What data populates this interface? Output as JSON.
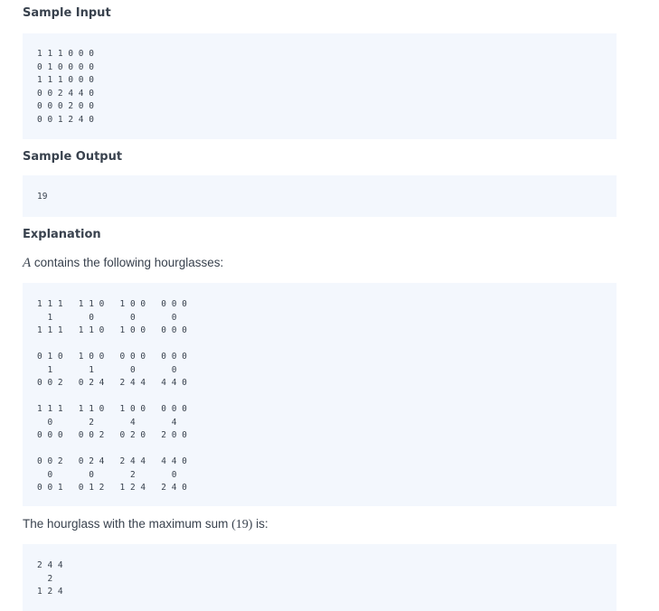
{
  "sample_input": {
    "heading": "Sample Input",
    "code": "1 1 1 0 0 0\n0 1 0 0 0 0\n1 1 1 0 0 0\n0 0 2 4 4 0\n0 0 0 2 0 0\n0 0 1 2 4 0"
  },
  "sample_output": {
    "heading": "Sample Output",
    "code": "19"
  },
  "explanation": {
    "heading": "Explanation",
    "math_var": "A",
    "intro_text": " contains the following hourglasses:",
    "hourglasses_code": "1 1 1   1 1 0   1 0 0   0 0 0\n  1       0       0       0\n1 1 1   1 1 0   1 0 0   0 0 0\n\n0 1 0   1 0 0   0 0 0   0 0 0\n  1       1       0       0\n0 0 2   0 2 4   2 4 4   4 4 0\n\n1 1 1   1 1 0   1 0 0   0 0 0\n  0       2       4       4\n0 0 0   0 0 2   0 2 0   2 0 0\n\n0 0 2   0 2 4   2 4 4   4 4 0\n  0       0       2       0\n0 0 1   0 1 2   1 2 4   2 4 0",
    "max_text_before": "The hourglass with the maximum sum ",
    "max_value": "(19)",
    "max_text_after": " is:",
    "max_code": "2 4 4\n  2\n1 2 4"
  }
}
